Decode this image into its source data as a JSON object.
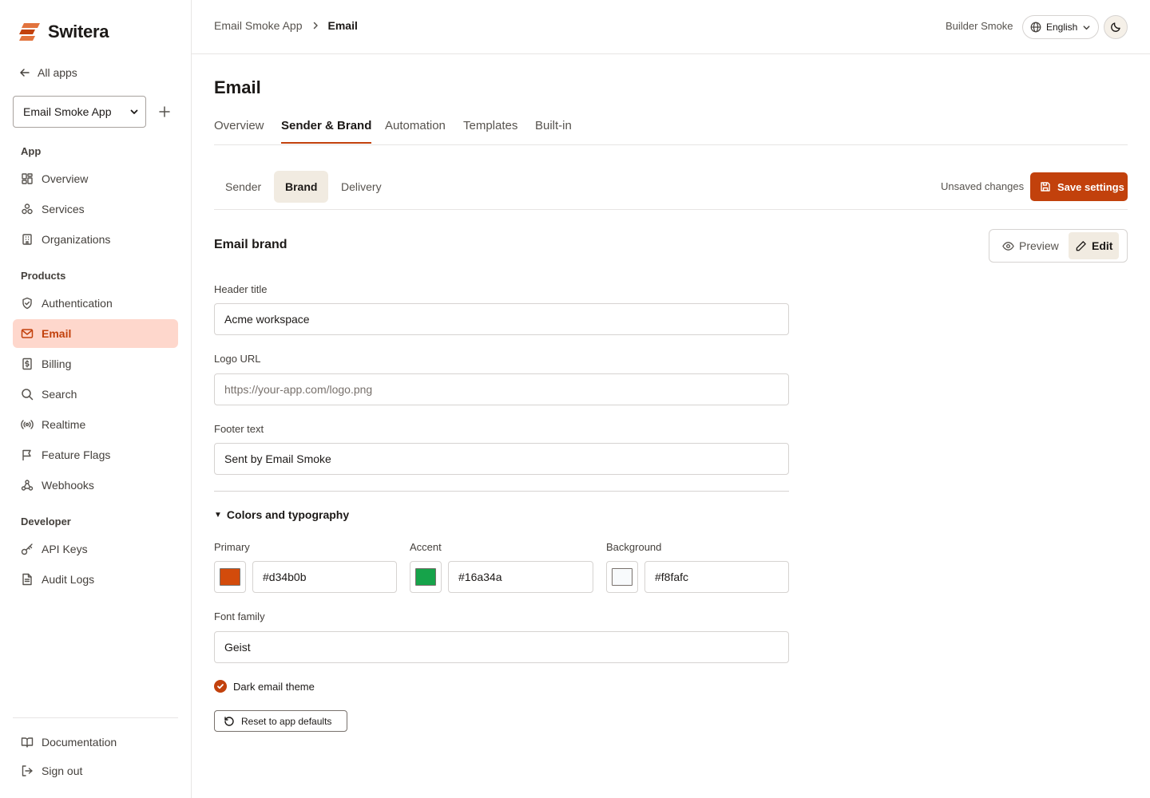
{
  "brand": {
    "name": "Switera",
    "accent": "#c2410c"
  },
  "sidebar": {
    "back_label": "All apps",
    "app_select": "Email Smoke App",
    "sections": {
      "app": "App",
      "products": "Products",
      "developer": "Developer"
    },
    "items": {
      "overview": "Overview",
      "services": "Services",
      "organizations": "Organizations",
      "authentication": "Authentication",
      "email": "Email",
      "billing": "Billing",
      "search": "Search",
      "realtime": "Realtime",
      "feature_flags": "Feature Flags",
      "webhooks": "Webhooks",
      "api_keys": "API Keys",
      "audit_logs": "Audit Logs"
    },
    "active_item": "email",
    "footer": {
      "documentation": "Documentation",
      "sign_out": "Sign out"
    }
  },
  "header": {
    "breadcrumb": [
      "Email Smoke App",
      "Email"
    ],
    "user": "Builder Smoke",
    "language": "English"
  },
  "page": {
    "title": "Email",
    "tabs": [
      "Overview",
      "Sender & Brand",
      "Automation",
      "Templates",
      "Built-in"
    ],
    "active_tab": "Sender & Brand",
    "sub_tabs": [
      "Sender",
      "Brand",
      "Delivery"
    ],
    "active_sub_tab": "Brand",
    "unsaved_label": "Unsaved changes",
    "save_label": "Save settings"
  },
  "brand_section": {
    "title": "Email brand",
    "view_toggle": {
      "preview": "Preview",
      "edit": "Edit",
      "active": "Edit"
    },
    "fields": {
      "header_title": {
        "label": "Header title",
        "value": "Acme workspace"
      },
      "logo_url": {
        "label": "Logo URL",
        "value": "",
        "placeholder": "https://your-app.com/logo.png"
      },
      "footer_text": {
        "label": "Footer text",
        "value": "Sent by Email Smoke"
      }
    },
    "colors_section": {
      "title": "Colors and typography",
      "expanded": true,
      "primary": {
        "label": "Primary",
        "value": "#d34b0b"
      },
      "accent": {
        "label": "Accent",
        "value": "#16a34a"
      },
      "background": {
        "label": "Background",
        "value": "#f8fafc"
      },
      "font_family": {
        "label": "Font family",
        "value": "Geist"
      },
      "dark_theme": {
        "label": "Dark email theme",
        "checked": true
      }
    },
    "reset_label": "Reset to app defaults"
  }
}
